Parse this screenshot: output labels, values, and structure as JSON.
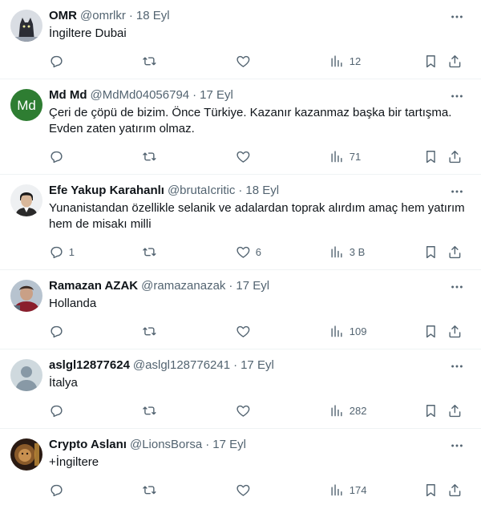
{
  "tweets": [
    {
      "name": "OMR",
      "handle": "@omrlkr",
      "time": "18 Eyl",
      "text": "İngiltere Dubai",
      "replies": "",
      "retweets": "",
      "likes": "",
      "views": "12",
      "avatar_icon": "cat-avatar"
    },
    {
      "name": "Md Md",
      "handle": "@MdMd04056794",
      "time": "17 Eyl",
      "text": "Çeri de çöpü de bizim.  Önce Türkiye. Kazanır kazanmaz başka bir tartışma. Evden zaten yatırım olmaz.",
      "replies": "",
      "retweets": "",
      "likes": "",
      "views": "71",
      "avatar_initials": "Md",
      "avatar_color": "#2e7d32"
    },
    {
      "name": "Efe Yakup Karahanlı",
      "handle": "@brutaIcritic",
      "time": "18 Eyl",
      "text": "Yunanistandan özellikle selanik ve adalardan toprak alırdım amaç hem yatırım hem de misakı milli",
      "replies": "1",
      "retweets": "",
      "likes": "6",
      "views": "3 B",
      "avatar_icon": "portrait-avatar"
    },
    {
      "name": "Ramazan AZAK",
      "handle": "@ramazanazak",
      "time": "17 Eyl",
      "text": "Hollanda",
      "replies": "",
      "retweets": "",
      "likes": "",
      "views": "109",
      "avatar_icon": "photo-avatar"
    },
    {
      "name": "aslgl12877624",
      "handle": "@aslgl128776241",
      "time": "17 Eyl",
      "text": "İtalya",
      "replies": "",
      "retweets": "",
      "likes": "",
      "views": "282",
      "avatar_icon": "default-avatar"
    },
    {
      "name": "Crypto Aslanı",
      "handle": "@LionsBorsa",
      "time": "17 Eyl",
      "text": "+İngiltere",
      "replies": "",
      "retweets": "",
      "likes": "",
      "views": "174",
      "avatar_icon": "lion-avatar"
    }
  ],
  "separator": "·",
  "colors": {
    "text": "#0f1419",
    "secondary": "#536471",
    "border": "#eff3f4"
  }
}
